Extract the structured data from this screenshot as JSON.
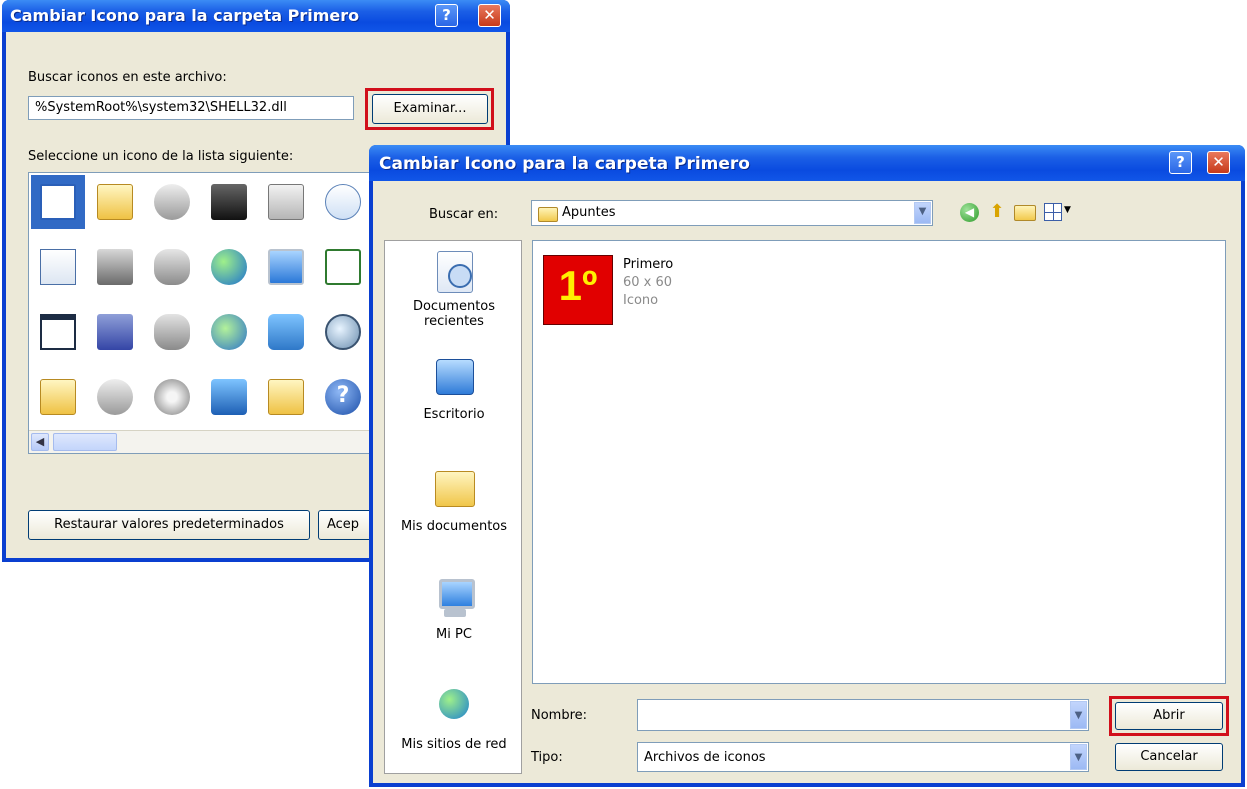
{
  "back_dialog": {
    "title": "Cambiar Icono para la carpeta Primero",
    "help_label": "?",
    "close_label": "✕",
    "search_label": "Buscar iconos en este archivo:",
    "file_path": "%SystemRoot%\\system32\\SHELL32.dll",
    "browse_button": "Examinar...",
    "select_label": "Seleccione un icono de la lista siguiente:",
    "restore_button": "Restaurar valores predeterminados",
    "accept_button": "Acep",
    "icons": [
      "document-window-icon",
      "folder-open-icon",
      "drive-icon",
      "chip-icon",
      "printer-icon",
      "clock-document-icon",
      "text-document-icon",
      "network-drive-icon",
      "drive-network-icon",
      "internet-globe-icon",
      "network-monitor-icon",
      "checklist-icon",
      "blank-window-icon",
      "floppy-drive-icon",
      "disconnected-drive-icon",
      "globe-mouse-icon",
      "network-computers-icon",
      "magnifier-icon",
      "folder-icon",
      "cd-drive-icon",
      "cd-icon",
      "monitors-icon",
      "control-folder-icon",
      "help-icon"
    ]
  },
  "front_dialog": {
    "title": "Cambiar Icono para la carpeta Primero",
    "help_label": "?",
    "close_label": "✕",
    "lookin_label": "Buscar en:",
    "lookin_value": "Apuntes",
    "places": [
      {
        "label": "Documentos recientes",
        "icon": "recent-documents-icon"
      },
      {
        "label": "Escritorio",
        "icon": "desktop-icon"
      },
      {
        "label": "Mis documentos",
        "icon": "my-documents-icon"
      },
      {
        "label": "Mi PC",
        "icon": "my-computer-icon"
      },
      {
        "label": "Mis sitios de red",
        "icon": "network-places-icon"
      }
    ],
    "file": {
      "thumb_text": "1º",
      "name": "Primero",
      "dims": "60 x 60",
      "type": "Icono"
    },
    "name_label": "Nombre:",
    "name_value": "",
    "type_label": "Tipo:",
    "type_value": "Archivos de iconos",
    "open_button": "Abrir",
    "cancel_button": "Cancelar"
  },
  "colors": {
    "title_blue": "#0a4be0",
    "dialog_bg": "#ece9d8",
    "highlight_red": "#d10f1b"
  }
}
